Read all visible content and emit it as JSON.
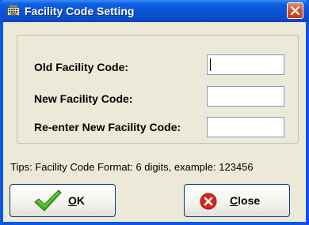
{
  "window": {
    "title": "Facility Code Setting",
    "icons": {
      "app": "keyboard-icon",
      "close": "close-icon"
    }
  },
  "form": {
    "old_label": "Old Facility Code:",
    "old_value": "",
    "new_label": "New Facility Code:",
    "new_value": "",
    "reenter_label": "Re-enter New Facility Code:",
    "reenter_value": ""
  },
  "tips": "Tips: Facility Code Format: 6 digits, example: 123456",
  "buttons": {
    "ok": {
      "mnemonic": "O",
      "rest": "K",
      "icon": "checkmark-icon"
    },
    "close": {
      "mnemonic": "C",
      "rest": "lose",
      "icon": "close-circle-icon"
    }
  },
  "colors": {
    "title_bar": "#0a52d6",
    "window_bg": "#ece9d8",
    "close_button": "#d8502b",
    "ok_icon": "#3fb21a",
    "close_icon": "#d8261a"
  }
}
